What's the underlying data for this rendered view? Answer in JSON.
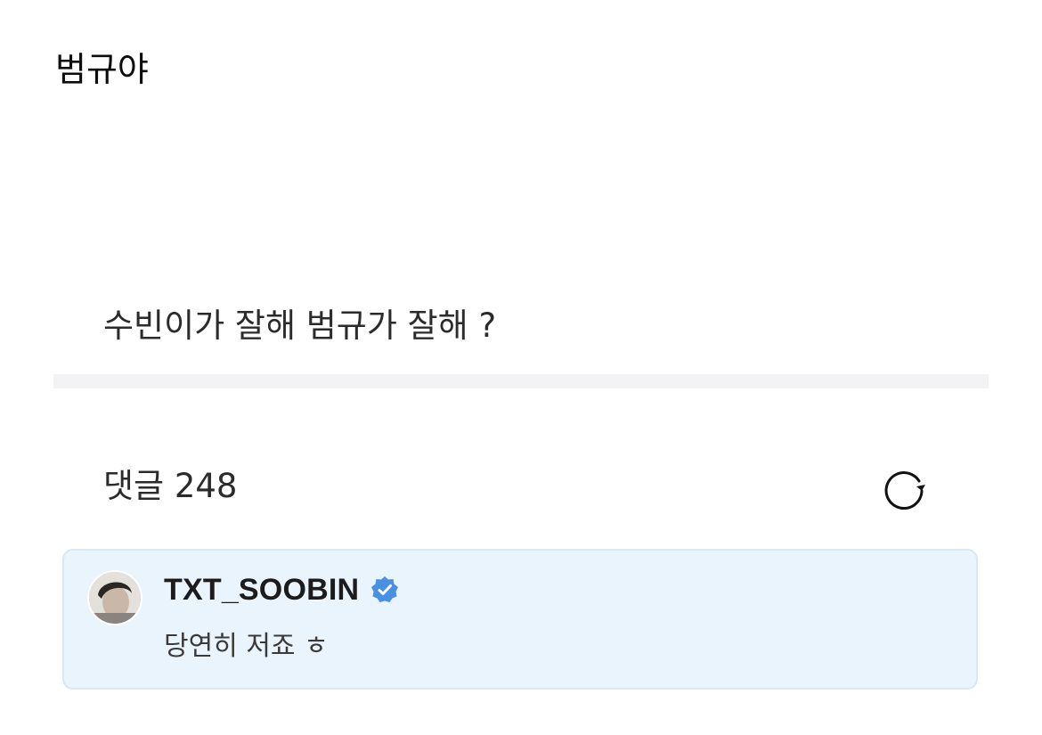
{
  "page": {
    "title": "범규야"
  },
  "post": {
    "question": "수빈이가 잘해 범규가 잘해 ?"
  },
  "comments": {
    "header": "댓글 248",
    "refresh_icon": "refresh-icon",
    "items": [
      {
        "author": "TXT_SOOBIN",
        "verified": true,
        "verified_icon": "verified-badge-icon",
        "text": "당연히 저죠 ㅎ",
        "highlight_color": "#eaf4fd",
        "badge_color": "#4a90e2"
      }
    ]
  }
}
